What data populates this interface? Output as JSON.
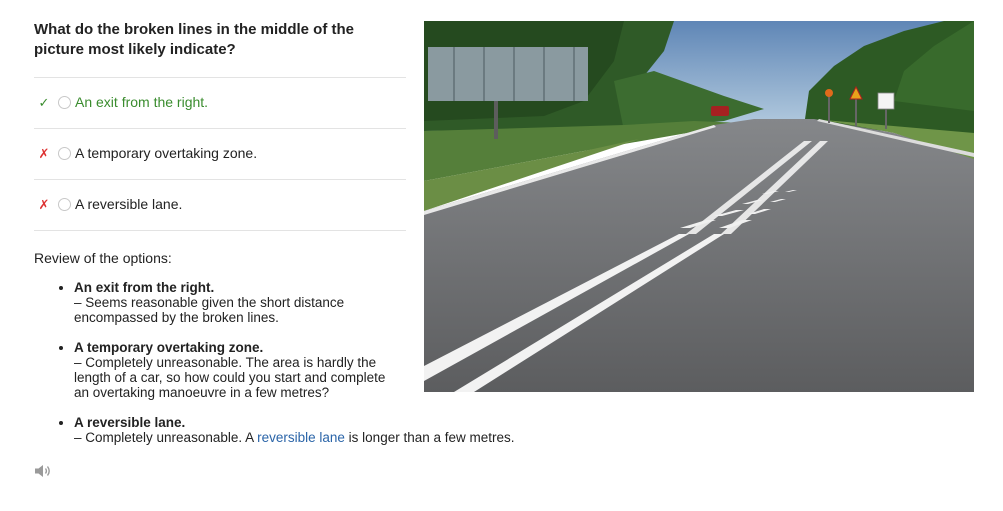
{
  "question": "What do the broken lines in the middle of the picture most likely indicate?",
  "options": [
    {
      "mark": "✓",
      "label": "An exit from the right.",
      "status": "correct"
    },
    {
      "mark": "✗",
      "label": "A temporary overtaking zone.",
      "status": "wrong"
    },
    {
      "mark": "✗",
      "label": "A reversible lane.",
      "status": "wrong"
    }
  ],
  "review": {
    "title": "Review of the options:",
    "items": [
      {
        "title": "An exit from the right.",
        "text": "– Seems reasonable given the short distance encompassed by the broken lines."
      },
      {
        "title": "A temporary overtaking zone.",
        "text": "– Completely unreasonable. The area is hardly the length of a car, so how could you start and complete an overtaking manoeuvre in a few metres?"
      },
      {
        "title": "A reversible lane.",
        "text_before": "– Completely unreasonable. A ",
        "link": "reversible lane",
        "text_after": " is longer than a few metres."
      }
    ]
  },
  "colors": {
    "correct": "#3a8c2e",
    "wrong": "#dd3333",
    "link": "#2a64a8"
  },
  "icons": {
    "audio": "speaker-icon",
    "correct": "checkmark-icon",
    "wrong": "cross-icon"
  }
}
